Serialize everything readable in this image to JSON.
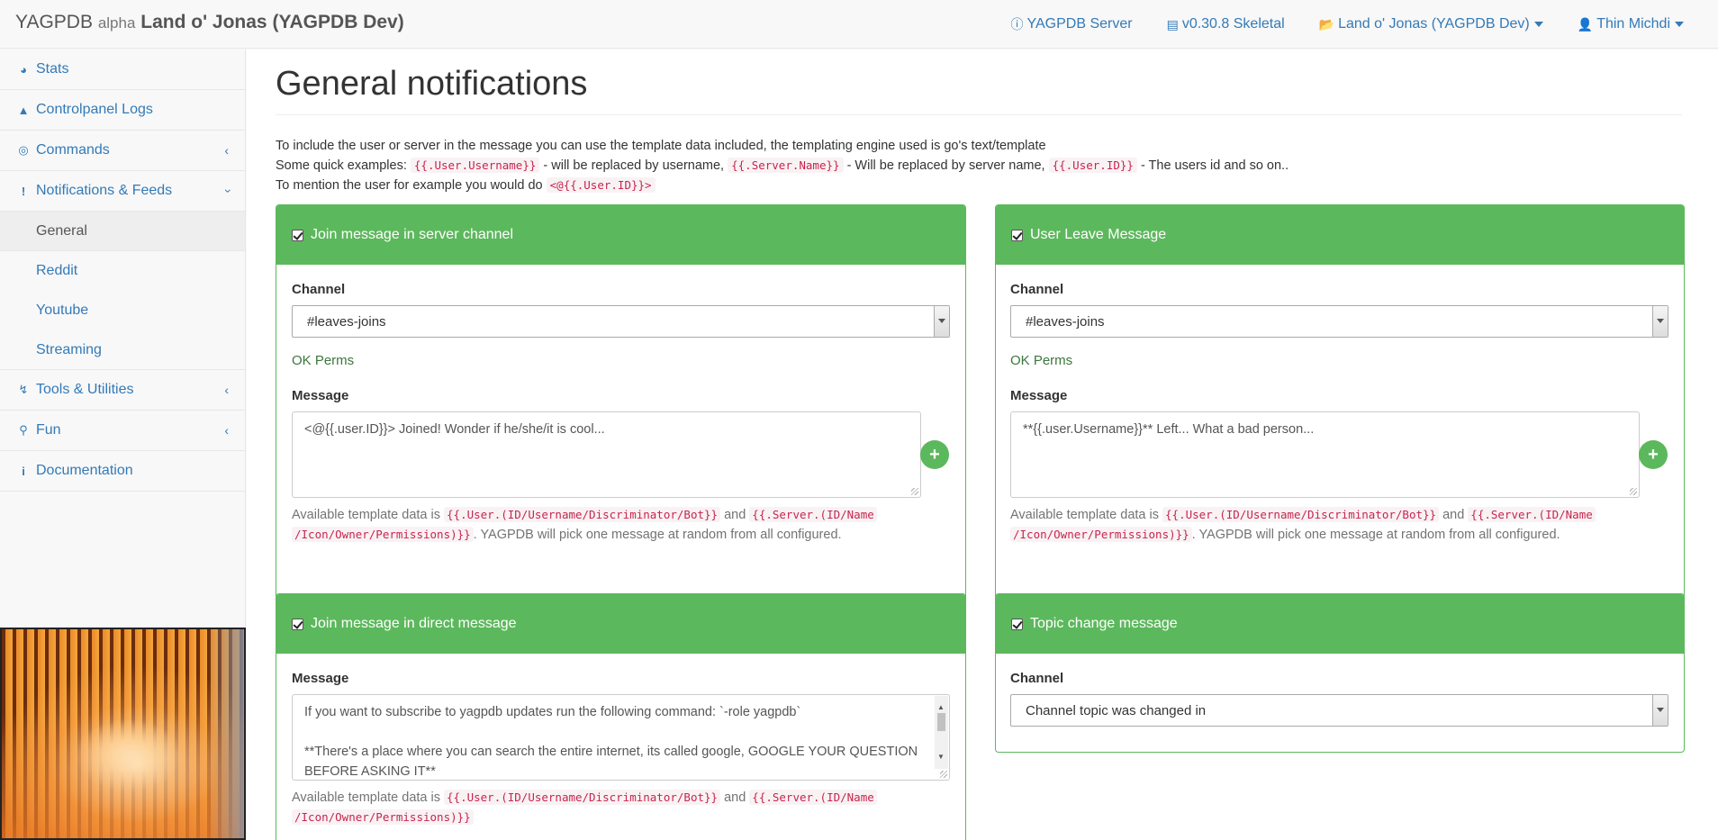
{
  "navbar": {
    "brand": "YAGPDB",
    "alpha": "alpha",
    "guild": "Land o' Jonas (YAGPDB Dev)",
    "links": [
      {
        "label": "YAGPDB Server",
        "icon": "info-circle-icon"
      },
      {
        "label": "v0.30.8 Skeletal",
        "icon": "newspaper-icon"
      },
      {
        "label": "Land o' Jonas (YAGPDB Dev)",
        "icon": "folder-open-icon"
      },
      {
        "label": "Thin Michdi",
        "icon": "user-icon"
      }
    ]
  },
  "sidebar": {
    "items": [
      {
        "label": "Stats",
        "icon": "dashboard-icon"
      },
      {
        "label": "Controlpanel Logs",
        "icon": "tree-icon"
      },
      {
        "label": "Commands",
        "icon": "bullseye-icon"
      },
      {
        "label": "Notifications & Feeds",
        "icon": "exclamation-icon"
      }
    ],
    "subitems": [
      {
        "label": "General"
      },
      {
        "label": "Reddit"
      },
      {
        "label": "Youtube"
      },
      {
        "label": "Streaming"
      }
    ],
    "items2": [
      {
        "label": "Tools & Utilities",
        "icon": "bolt-icon"
      },
      {
        "label": "Fun",
        "icon": "trophy-icon"
      },
      {
        "label": "Documentation",
        "icon": "info-icon"
      }
    ]
  },
  "main": {
    "title": "General notifications",
    "intro": {
      "line1": "To include the user or server in the message you can use the template data included, the templating engine used is go's text/template",
      "line2a": "Some quick examples: ",
      "code1": "{{.User.Username}}",
      "line2b": " - will be replaced by username, ",
      "code2": "{{.Server.Name}}",
      "line2c": " - Will be replaced by server name, ",
      "code3": "{{.User.ID}}",
      "line2d": " - The users id and so on..",
      "line3a": "To mention the user for example you would do ",
      "code4": "<@{{.User.ID}}>"
    },
    "panels": {
      "join_server": {
        "title": "Join message in server channel",
        "channel_label": "Channel",
        "channel_value": "#leaves-joins",
        "perms": "OK Perms",
        "message_label": "Message",
        "message": "<@{{.user.ID}}> Joined! Wonder if he/she/it is cool...",
        "help_a": "Available template data is ",
        "help_code1": "{{.User.(ID/Username/Discriminator/Bot}}",
        "help_b": " and ",
        "help_code2": "{{.Server.(ID/Name",
        "help_code3": "/Icon/Owner/Permissions)}}",
        "help_c": ". YAGPDB will pick one message at random from all configured."
      },
      "leave": {
        "title": "User Leave Message",
        "channel_label": "Channel",
        "channel_value": "#leaves-joins",
        "perms": "OK Perms",
        "message_label": "Message",
        "message": "**{{.user.Username}}** Left... What a bad person...",
        "help_a": "Available template data is ",
        "help_code1": "{{.User.(ID/Username/Discriminator/Bot}}",
        "help_b": " and ",
        "help_code2": "{{.Server.(ID/Name",
        "help_code3": "/Icon/Owner/Permissions)}}",
        "help_c": ". YAGPDB will pick one message at random from all configured."
      },
      "join_dm": {
        "title": "Join message in direct message",
        "message_label": "Message",
        "message_line1": "If you want to subscribe to yagpdb updates run the following command: `-role yagpdb`",
        "message_line2": "**There's a place where you can search the entire internet, its called google, GOOGLE YOUR QUESTION BEFORE ASKING IT**",
        "help_a": "Available template data is ",
        "help_code1": "{{.User.(ID/Username/Discriminator/Bot}}",
        "help_b": " and ",
        "help_code2": "{{.Server.(ID/Name",
        "help_code3": "/Icon/Owner/Permissions)}}"
      },
      "topic": {
        "title": "Topic change message",
        "channel_label": "Channel",
        "channel_value": "Channel topic was changed in"
      }
    }
  },
  "colors": {
    "accent": "#5cb85c",
    "link": "#337ab7",
    "code": "#c7254e",
    "ok": "#3c763d"
  }
}
